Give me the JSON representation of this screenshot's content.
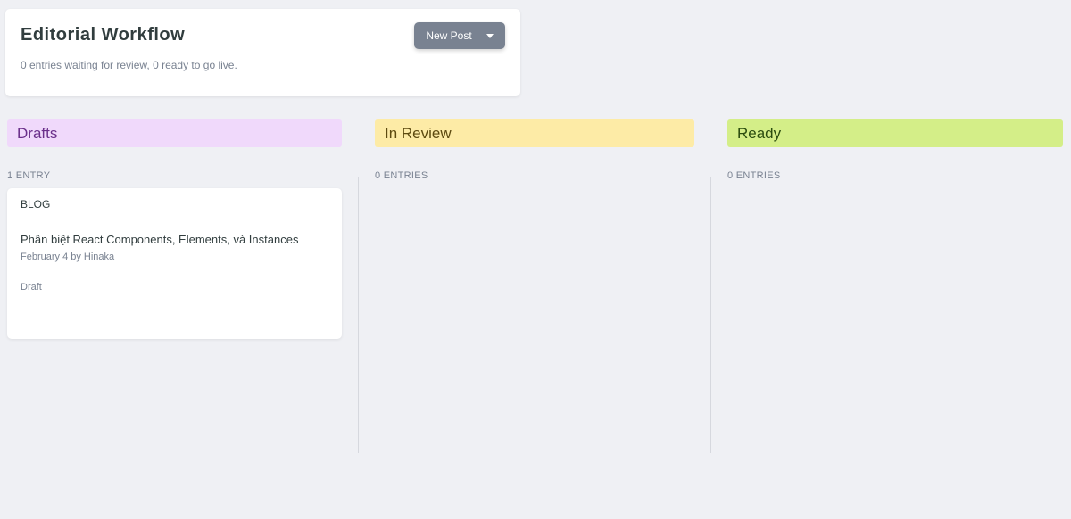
{
  "header": {
    "title": "Editorial Workflow",
    "subtitle": "0 entries waiting for review, 0 ready to go live.",
    "new_post_label": "New Post",
    "dropdown_icon": "chevron-down-icon"
  },
  "columns": [
    {
      "title": "Drafts",
      "count": "1 ENTRY",
      "color": "#f0d9fb",
      "entries": [
        {
          "collection": "BLOG",
          "title": "Phân biệt React Components, Elements, và Instances",
          "meta": "February 4 by Hinaka",
          "status": "Draft"
        }
      ]
    },
    {
      "title": "In Review",
      "count": "0 ENTRIES",
      "color": "#fdeba6",
      "entries": []
    },
    {
      "title": "Ready",
      "count": "0 ENTRIES",
      "color": "#d4ee88",
      "entries": []
    }
  ],
  "colors": {
    "background": "#eff0f4",
    "button": "#798291",
    "text_primary": "#313d3e",
    "text_secondary": "#798291"
  }
}
